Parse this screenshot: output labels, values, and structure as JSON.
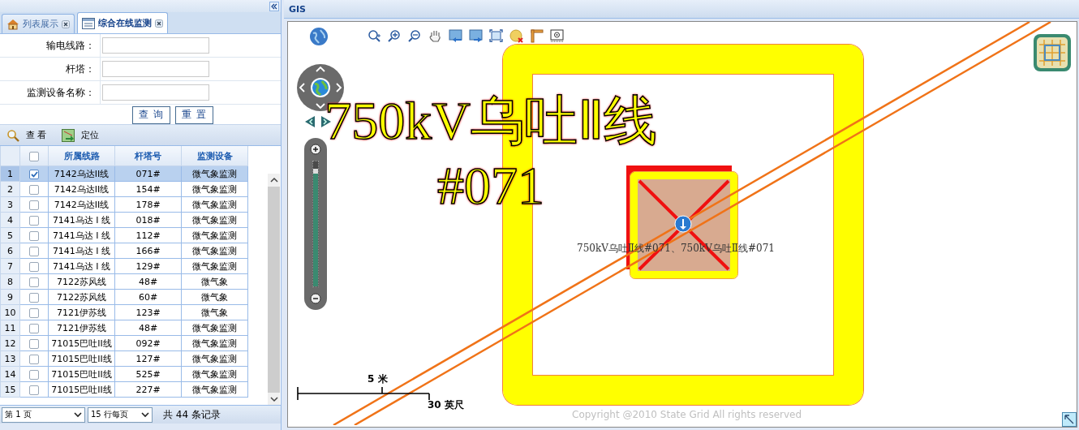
{
  "tabs": [
    {
      "label": "列表展示",
      "selected": false
    },
    {
      "label": "综合在线监测",
      "selected": true
    }
  ],
  "search_form": {
    "fields": [
      {
        "label": "输电线路："
      },
      {
        "label": "杆塔："
      },
      {
        "label": "监测设备名称："
      }
    ],
    "buttons": [
      "查 询",
      "重 置"
    ]
  },
  "toolbar": [
    "查 看",
    "定位"
  ],
  "table": {
    "all_checked": false,
    "columns": [
      "所属线路",
      "杆塔号",
      "监测设备"
    ],
    "rows": [
      {
        "number": "1",
        "checked": true,
        "selected": true,
        "line": "7142乌达II线",
        "tower": "071#",
        "device": "微气象监测"
      },
      {
        "number": "2",
        "checked": false,
        "selected": false,
        "line": "7142乌达II线",
        "tower": "154#",
        "device": "微气象监测"
      },
      {
        "number": "3",
        "checked": false,
        "selected": false,
        "line": "7142乌达II线",
        "tower": "178#",
        "device": "微气象监测"
      },
      {
        "number": "4",
        "checked": false,
        "selected": false,
        "line": "7141乌达 I 线",
        "tower": "018#",
        "device": "微气象监测"
      },
      {
        "number": "5",
        "checked": false,
        "selected": false,
        "line": "7141乌达 I 线",
        "tower": "112#",
        "device": "微气象监测"
      },
      {
        "number": "6",
        "checked": false,
        "selected": false,
        "line": "7141乌达 I 线",
        "tower": "166#",
        "device": "微气象监测"
      },
      {
        "number": "7",
        "checked": false,
        "selected": false,
        "line": "7141乌达 I 线",
        "tower": "129#",
        "device": "微气象监测"
      },
      {
        "number": "8",
        "checked": false,
        "selected": false,
        "line": "7122苏风线",
        "tower": "48#",
        "device": "微气象"
      },
      {
        "number": "9",
        "checked": false,
        "selected": false,
        "line": "7122苏风线",
        "tower": "60#",
        "device": "微气象"
      },
      {
        "number": "10",
        "checked": false,
        "selected": false,
        "line": "7121伊苏线",
        "tower": "123#",
        "device": "微气象"
      },
      {
        "number": "11",
        "checked": false,
        "selected": false,
        "line": "7121伊苏线",
        "tower": "48#",
        "device": "微气象监测"
      },
      {
        "number": "12",
        "checked": false,
        "selected": false,
        "line": "71015巴吐II线",
        "tower": "092#",
        "device": "微气象监测"
      },
      {
        "number": "13",
        "checked": false,
        "selected": false,
        "line": "71015巴吐II线",
        "tower": "127#",
        "device": "微气象监测"
      },
      {
        "number": "14",
        "checked": false,
        "selected": false,
        "line": "71015巴吐II线",
        "tower": "525#",
        "device": "微气象监测"
      },
      {
        "number": "15",
        "checked": false,
        "selected": false,
        "line": "71015巴吐II线",
        "tower": "227#",
        "device": "微气象监测"
      }
    ]
  },
  "pager": {
    "page": "第 1 页",
    "page_size": "15 行每页",
    "total": "共 44 条记录"
  },
  "gis": {
    "title": "GIS",
    "map": {
      "zoom_slider": {
        "level": 0.9
      },
      "big_label": "750kV乌吐Ⅱ线#071",
      "point_label": "750kV乌吐Ⅱ线#071、750kV乌吐Ⅱ线#071",
      "scale_top": "5 米",
      "scale_bottom": "30 英尺",
      "copyright": "Copyright @2010 State Grid All rights reserved"
    }
  }
}
